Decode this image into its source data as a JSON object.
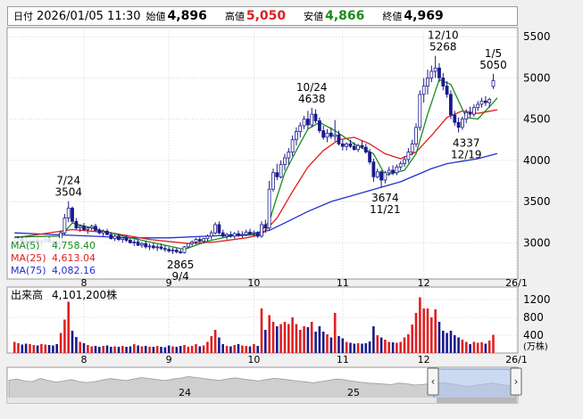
{
  "header": {
    "date_label": "日付",
    "date": "2026/01/05 11:30",
    "open_label": "始値",
    "open": "4,896",
    "high_label": "高値",
    "high": "5,050",
    "low_label": "安値",
    "low": "4,866",
    "close_label": "終値",
    "close": "4,969"
  },
  "colors": {
    "up": "#ffffff",
    "down": "#1a1a8c",
    "ma5": "#1a8c1a",
    "ma25": "#e02020",
    "ma75": "#2030d0",
    "vol_up": "#e02020",
    "vol_down": "#1a1a8c"
  },
  "legend": [
    {
      "name": "MA(5)",
      "value": "4,758.40"
    },
    {
      "name": "MA(25)",
      "value": "4,613.04"
    },
    {
      "name": "MA(75)",
      "value": "4,082.16"
    }
  ],
  "volume_label": "出来高",
  "volume_value": "4,101,200株",
  "volume_unit": "(万株)",
  "navigator_labels": [
    "24",
    "25"
  ],
  "chart_data": {
    "type": "candlestick",
    "price_axis": {
      "ticks": [
        3000,
        3500,
        4000,
        4500,
        5000,
        5500
      ],
      "ylim": [
        2560,
        5610
      ]
    },
    "volume_axis": {
      "ticks": [
        400,
        800,
        1200
      ],
      "ylim": [
        0,
        1400
      ]
    },
    "months": [
      {
        "label": "8",
        "index": 18
      },
      {
        "label": "9",
        "index": 40
      },
      {
        "label": "10",
        "index": 62
      },
      {
        "label": "11",
        "index": 85
      },
      {
        "label": "12",
        "index": 106
      },
      {
        "label": "26/1",
        "index": 130
      }
    ],
    "annotations": [
      {
        "index": 14,
        "value": 3504,
        "text": [
          "7/24",
          "3504"
        ],
        "position": "above"
      },
      {
        "index": 43,
        "value": 2865,
        "text": [
          "2865",
          "9/4"
        ],
        "position": "below"
      },
      {
        "index": 77,
        "value": 4638,
        "text": [
          "10/24",
          "4638"
        ],
        "position": "above"
      },
      {
        "index": 96,
        "value": 3674,
        "text": [
          "3674",
          "11/21"
        ],
        "position": "below"
      },
      {
        "index": 111,
        "value": 5268,
        "text": [
          "12/10",
          "5268"
        ],
        "position": "above"
      },
      {
        "index": 117,
        "value": 4337,
        "text": [
          "4337",
          "12/19"
        ],
        "position": "below"
      },
      {
        "index": 124,
        "value": 5050,
        "text": [
          "1/5",
          "5050"
        ],
        "position": "above"
      }
    ],
    "candles": [
      [
        3000,
        3050,
        2940,
        3020,
        250
      ],
      [
        3020,
        3080,
        2990,
        3050,
        220
      ],
      [
        3050,
        3080,
        3000,
        3020,
        190
      ],
      [
        3020,
        3060,
        2970,
        3000,
        210
      ],
      [
        3000,
        3040,
        2950,
        3010,
        200
      ],
      [
        3010,
        3050,
        2980,
        3030,
        180
      ],
      [
        3030,
        3060,
        2990,
        3000,
        170
      ],
      [
        3000,
        3040,
        2960,
        3020,
        200
      ],
      [
        3020,
        3060,
        2990,
        3040,
        190
      ],
      [
        3040,
        3070,
        3000,
        3010,
        180
      ],
      [
        3010,
        3040,
        2970,
        3000,
        170
      ],
      [
        3000,
        3030,
        2950,
        2980,
        200
      ],
      [
        2980,
        3150,
        2960,
        3120,
        450
      ],
      [
        3120,
        3350,
        3100,
        3300,
        750
      ],
      [
        3300,
        3504,
        3250,
        3420,
        1150
      ],
      [
        3420,
        3440,
        3240,
        3260,
        500
      ],
      [
        3260,
        3300,
        3160,
        3180,
        360
      ],
      [
        3180,
        3220,
        3130,
        3200,
        250
      ],
      [
        3200,
        3240,
        3150,
        3160,
        220
      ],
      [
        3160,
        3200,
        3110,
        3180,
        180
      ],
      [
        3180,
        3220,
        3150,
        3200,
        150
      ],
      [
        3200,
        3230,
        3140,
        3150,
        160
      ],
      [
        3150,
        3180,
        3100,
        3120,
        140
      ],
      [
        3120,
        3160,
        3080,
        3140,
        160
      ],
      [
        3140,
        3170,
        3090,
        3100,
        170
      ],
      [
        3100,
        3130,
        3040,
        3050,
        140
      ],
      [
        3050,
        3100,
        3020,
        3080,
        150
      ],
      [
        3080,
        3110,
        3020,
        3040,
        140
      ],
      [
        3040,
        3070,
        3000,
        3060,
        160
      ],
      [
        3060,
        3090,
        3010,
        3030,
        140
      ],
      [
        3030,
        3060,
        2990,
        3000,
        150
      ],
      [
        3000,
        3040,
        2960,
        3010,
        200
      ],
      [
        3010,
        3040,
        2960,
        2970,
        170
      ],
      [
        2970,
        3010,
        2940,
        2990,
        150
      ],
      [
        2990,
        3020,
        2930,
        2950,
        160
      ],
      [
        2950,
        2990,
        2910,
        2960,
        140
      ],
      [
        2960,
        3000,
        2920,
        2940,
        140
      ],
      [
        2940,
        2980,
        2900,
        2950,
        160
      ],
      [
        2950,
        2990,
        2910,
        2930,
        140
      ],
      [
        2930,
        2970,
        2890,
        2920,
        130
      ],
      [
        2920,
        2950,
        2880,
        2900,
        170
      ],
      [
        2900,
        2940,
        2865,
        2910,
        150
      ],
      [
        2910,
        2940,
        2870,
        2890,
        140
      ],
      [
        2890,
        2920,
        2865,
        2880,
        160
      ],
      [
        2880,
        2960,
        2870,
        2950,
        180
      ],
      [
        2950,
        3000,
        2930,
        2990,
        140
      ],
      [
        2990,
        3030,
        2960,
        3010,
        160
      ],
      [
        3010,
        3060,
        2980,
        3040,
        200
      ],
      [
        3040,
        3070,
        3000,
        3020,
        150
      ],
      [
        3020,
        3060,
        2990,
        3050,
        170
      ],
      [
        3050,
        3100,
        3020,
        3080,
        250
      ],
      [
        3080,
        3150,
        3040,
        3120,
        380
      ],
      [
        3120,
        3250,
        3100,
        3220,
        520
      ],
      [
        3220,
        3260,
        3100,
        3120,
        350
      ],
      [
        3120,
        3160,
        3060,
        3080,
        200
      ],
      [
        3080,
        3120,
        3040,
        3100,
        160
      ],
      [
        3100,
        3140,
        3060,
        3080,
        150
      ],
      [
        3080,
        3130,
        3050,
        3110,
        180
      ],
      [
        3110,
        3150,
        3070,
        3090,
        200
      ],
      [
        3090,
        3140,
        3060,
        3100,
        170
      ],
      [
        3100,
        3160,
        3080,
        3130,
        160
      ],
      [
        3130,
        3170,
        3090,
        3110,
        150
      ],
      [
        3110,
        3150,
        3080,
        3120,
        200
      ],
      [
        3120,
        3140,
        3060,
        3080,
        160
      ],
      [
        3080,
        3260,
        3060,
        3220,
        1000
      ],
      [
        3220,
        3280,
        3120,
        3180,
        520
      ],
      [
        3180,
        3750,
        3150,
        3650,
        850
      ],
      [
        3650,
        3900,
        3620,
        3850,
        700
      ],
      [
        3850,
        3960,
        3760,
        3800,
        600
      ],
      [
        3800,
        4000,
        3780,
        3950,
        650
      ],
      [
        3950,
        4080,
        3880,
        4030,
        700
      ],
      [
        4030,
        4150,
        3950,
        4100,
        650
      ],
      [
        4100,
        4300,
        4050,
        4250,
        800
      ],
      [
        4250,
        4400,
        4180,
        4350,
        650
      ],
      [
        4350,
        4460,
        4280,
        4420,
        520
      ],
      [
        4420,
        4540,
        4380,
        4500,
        600
      ],
      [
        4500,
        4600,
        4380,
        4430,
        580
      ],
      [
        4430,
        4638,
        4400,
        4560,
        700
      ],
      [
        4560,
        4620,
        4450,
        4480,
        480
      ],
      [
        4480,
        4520,
        4330,
        4360,
        600
      ],
      [
        4360,
        4420,
        4250,
        4280,
        480
      ],
      [
        4280,
        4380,
        4220,
        4330,
        420
      ],
      [
        4330,
        4400,
        4260,
        4290,
        350
      ],
      [
        4290,
        4490,
        4230,
        4310,
        900
      ],
      [
        4310,
        4360,
        4180,
        4200,
        380
      ],
      [
        4200,
        4250,
        4120,
        4170,
        330
      ],
      [
        4170,
        4220,
        4120,
        4200,
        250
      ],
      [
        4200,
        4250,
        4150,
        4170,
        230
      ],
      [
        4170,
        4220,
        4120,
        4130,
        210
      ],
      [
        4130,
        4200,
        4100,
        4180,
        220
      ],
      [
        4180,
        4240,
        4140,
        4160,
        210
      ],
      [
        4160,
        4200,
        4080,
        4100,
        220
      ],
      [
        4100,
        4140,
        3950,
        3980,
        260
      ],
      [
        3980,
        4020,
        3740,
        3800,
        600
      ],
      [
        3800,
        3900,
        3780,
        3860,
        400
      ],
      [
        3860,
        3880,
        3674,
        3760,
        350
      ],
      [
        3760,
        3870,
        3720,
        3850,
        300
      ],
      [
        3850,
        3920,
        3810,
        3880,
        250
      ],
      [
        3880,
        3940,
        3820,
        3850,
        240
      ],
      [
        3850,
        3950,
        3820,
        3920,
        230
      ],
      [
        3920,
        3990,
        3880,
        3960,
        250
      ],
      [
        3960,
        4050,
        3920,
        4010,
        350
      ],
      [
        4010,
        4150,
        3970,
        4100,
        420
      ],
      [
        4100,
        4250,
        4060,
        4200,
        640
      ],
      [
        4200,
        4450,
        4160,
        4400,
        900
      ],
      [
        4400,
        4850,
        4360,
        4800,
        1250
      ],
      [
        4800,
        5000,
        4700,
        4900,
        1000
      ],
      [
        4900,
        5100,
        4800,
        5000,
        1000
      ],
      [
        5000,
        5150,
        4950,
        5080,
        800
      ],
      [
        5080,
        5268,
        5000,
        5120,
        980
      ],
      [
        5120,
        5180,
        4950,
        5000,
        700
      ],
      [
        5000,
        5060,
        4850,
        4900,
        500
      ],
      [
        4900,
        4960,
        4760,
        4800,
        450
      ],
      [
        4800,
        4850,
        4500,
        4550,
        500
      ],
      [
        4550,
        4600,
        4420,
        4460,
        400
      ],
      [
        4460,
        4520,
        4337,
        4400,
        350
      ],
      [
        4400,
        4530,
        4370,
        4500,
        300
      ],
      [
        4500,
        4620,
        4450,
        4580,
        250
      ],
      [
        4580,
        4650,
        4520,
        4560,
        200
      ],
      [
        4560,
        4680,
        4530,
        4640,
        250
      ],
      [
        4640,
        4720,
        4600,
        4680,
        230
      ],
      [
        4680,
        4760,
        4640,
        4720,
        240
      ],
      [
        4720,
        4780,
        4660,
        4700,
        210
      ],
      [
        4700,
        4760,
        4640,
        4740,
        280
      ],
      [
        4896,
        5050,
        4866,
        4969,
        410
      ]
    ],
    "ma5": [
      [
        0,
        3070
      ],
      [
        12,
        3080
      ],
      [
        15,
        3240
      ],
      [
        20,
        3180
      ],
      [
        30,
        3060
      ],
      [
        40,
        2960
      ],
      [
        44,
        2920
      ],
      [
        50,
        3020
      ],
      [
        56,
        3080
      ],
      [
        63,
        3100
      ],
      [
        66,
        3260
      ],
      [
        68,
        3560
      ],
      [
        70,
        3850
      ],
      [
        73,
        4120
      ],
      [
        76,
        4380
      ],
      [
        79,
        4460
      ],
      [
        83,
        4360
      ],
      [
        88,
        4200
      ],
      [
        93,
        4080
      ],
      [
        96,
        3820
      ],
      [
        101,
        3880
      ],
      [
        104,
        4080
      ],
      [
        107,
        4560
      ],
      [
        110,
        4980
      ],
      [
        113,
        4920
      ],
      [
        117,
        4520
      ],
      [
        120,
        4500
      ],
      [
        124,
        4700
      ],
      [
        125,
        4758
      ]
    ],
    "ma25": [
      [
        0,
        3060
      ],
      [
        15,
        3160
      ],
      [
        25,
        3120
      ],
      [
        35,
        3040
      ],
      [
        45,
        2990
      ],
      [
        52,
        3010
      ],
      [
        60,
        3060
      ],
      [
        64,
        3100
      ],
      [
        68,
        3300
      ],
      [
        72,
        3620
      ],
      [
        76,
        3920
      ],
      [
        80,
        4120
      ],
      [
        84,
        4250
      ],
      [
        88,
        4280
      ],
      [
        92,
        4200
      ],
      [
        96,
        4080
      ],
      [
        100,
        4020
      ],
      [
        104,
        4100
      ],
      [
        108,
        4300
      ],
      [
        112,
        4520
      ],
      [
        116,
        4600
      ],
      [
        120,
        4570
      ],
      [
        125,
        4613
      ]
    ],
    "ma75": [
      [
        0,
        3120
      ],
      [
        10,
        3100
      ],
      [
        20,
        3080
      ],
      [
        30,
        3060
      ],
      [
        40,
        3060
      ],
      [
        50,
        3080
      ],
      [
        60,
        3100
      ],
      [
        66,
        3150
      ],
      [
        70,
        3240
      ],
      [
        76,
        3380
      ],
      [
        82,
        3500
      ],
      [
        88,
        3580
      ],
      [
        94,
        3660
      ],
      [
        100,
        3740
      ],
      [
        104,
        3820
      ],
      [
        108,
        3900
      ],
      [
        112,
        3960
      ],
      [
        116,
        3990
      ],
      [
        120,
        4020
      ],
      [
        125,
        4082
      ]
    ],
    "navigator_line": [
      0.55,
      0.6,
      0.52,
      0.5,
      0.62,
      0.55,
      0.48,
      0.52,
      0.58,
      0.5,
      0.46,
      0.5,
      0.56,
      0.62,
      0.58,
      0.54,
      0.6,
      0.66,
      0.62,
      0.58,
      0.54,
      0.6,
      0.64,
      0.7,
      0.66,
      0.62,
      0.58,
      0.55,
      0.6,
      0.65,
      0.6,
      0.56,
      0.52,
      0.58,
      0.63,
      0.6,
      0.56,
      0.52,
      0.49,
      0.45,
      0.5,
      0.55,
      0.6,
      0.57,
      0.52,
      0.48,
      0.44,
      0.42,
      0.4,
      0.38,
      0.44,
      0.41,
      0.36,
      0.38,
      0.42,
      0.46,
      0.44,
      0.4,
      0.34,
      0.3,
      0.36,
      0.4,
      0.44,
      0.38,
      0.34,
      0.3
    ]
  }
}
